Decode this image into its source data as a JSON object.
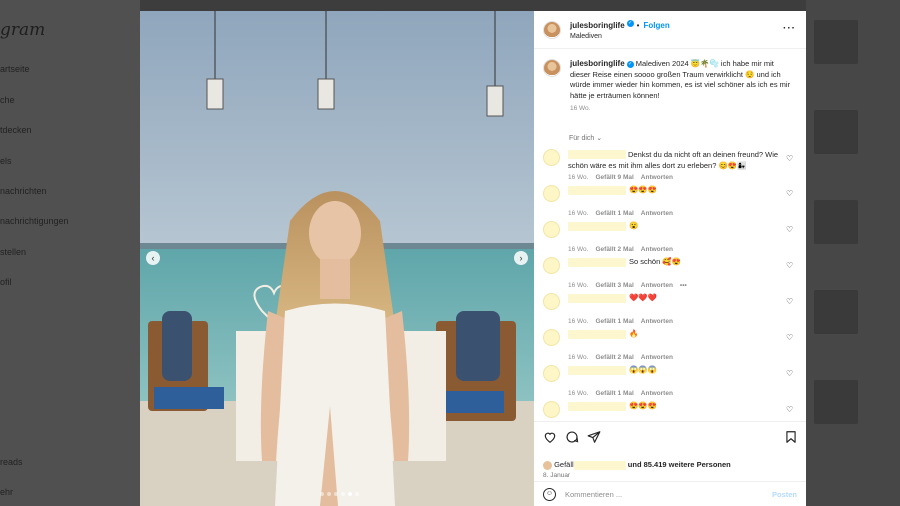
{
  "background": {
    "logo": "gram",
    "nav": [
      "artseite",
      "che",
      "tdecken",
      "els",
      "nachrichten",
      "nachrichtigungen",
      "stellen",
      "ofil",
      "reads",
      "ehr"
    ]
  },
  "post": {
    "username": "julesboringlife",
    "follow_label": "Folgen",
    "location": "Malediven",
    "more_icon": "more-horizontal-icon",
    "caption": "Malediven 2024 😇🌴🫧 ich habe mir mit dieser Reise einen soooo großen Traum verwirklicht 😌 und ich würde immer wieder hin kommen, es ist viel schöner als ich es mir hätte je erträumen können!",
    "caption_time": "16 Wo.",
    "sort_label": "Für dich",
    "comments": [
      {
        "text": "Denkst du da nicht oft an deinen freund? Wie schön wäre es mit ihm alles dort zu erleben? 😊😍👩‍👧",
        "time": "16 Wo.",
        "likes": "Gefällt 9 Mal",
        "reply": "Antworten"
      },
      {
        "text": "😍😍😍",
        "time": "16 Wo.",
        "likes": "Gefällt 1 Mal",
        "reply": "Antworten"
      },
      {
        "text": "😮",
        "time": "16 Wo.",
        "likes": "Gefällt 2 Mal",
        "reply": "Antworten"
      },
      {
        "text": "So schön 🥰😍",
        "time": "16 Wo.",
        "likes": "Gefällt 3 Mal",
        "reply": "Antworten",
        "options": "•••"
      },
      {
        "text": "❤️❤️❤️",
        "time": "16 Wo.",
        "likes": "Gefällt 1 Mal",
        "reply": "Antworten"
      },
      {
        "text": "🔥",
        "time": "16 Wo.",
        "likes": "Gefällt 2 Mal",
        "reply": "Antworten"
      },
      {
        "text": "😱😱😱",
        "time": "16 Wo.",
        "likes": "Gefällt 1 Mal",
        "reply": "Antworten"
      },
      {
        "text": "😍😍😍",
        "time": "16 Wo.",
        "likes": "Gefällt 1 Mal",
        "reply": "Antworten"
      }
    ],
    "likes_prefix": "Gefäll",
    "likes_suffix": "und 85.419 weitere Personen",
    "date": "8. Januar",
    "comment_placeholder": "Kommentieren ...",
    "post_label": "Posten",
    "carousel": {
      "count": 6,
      "active_index": 4
    },
    "accent_color": "#0095f6"
  }
}
